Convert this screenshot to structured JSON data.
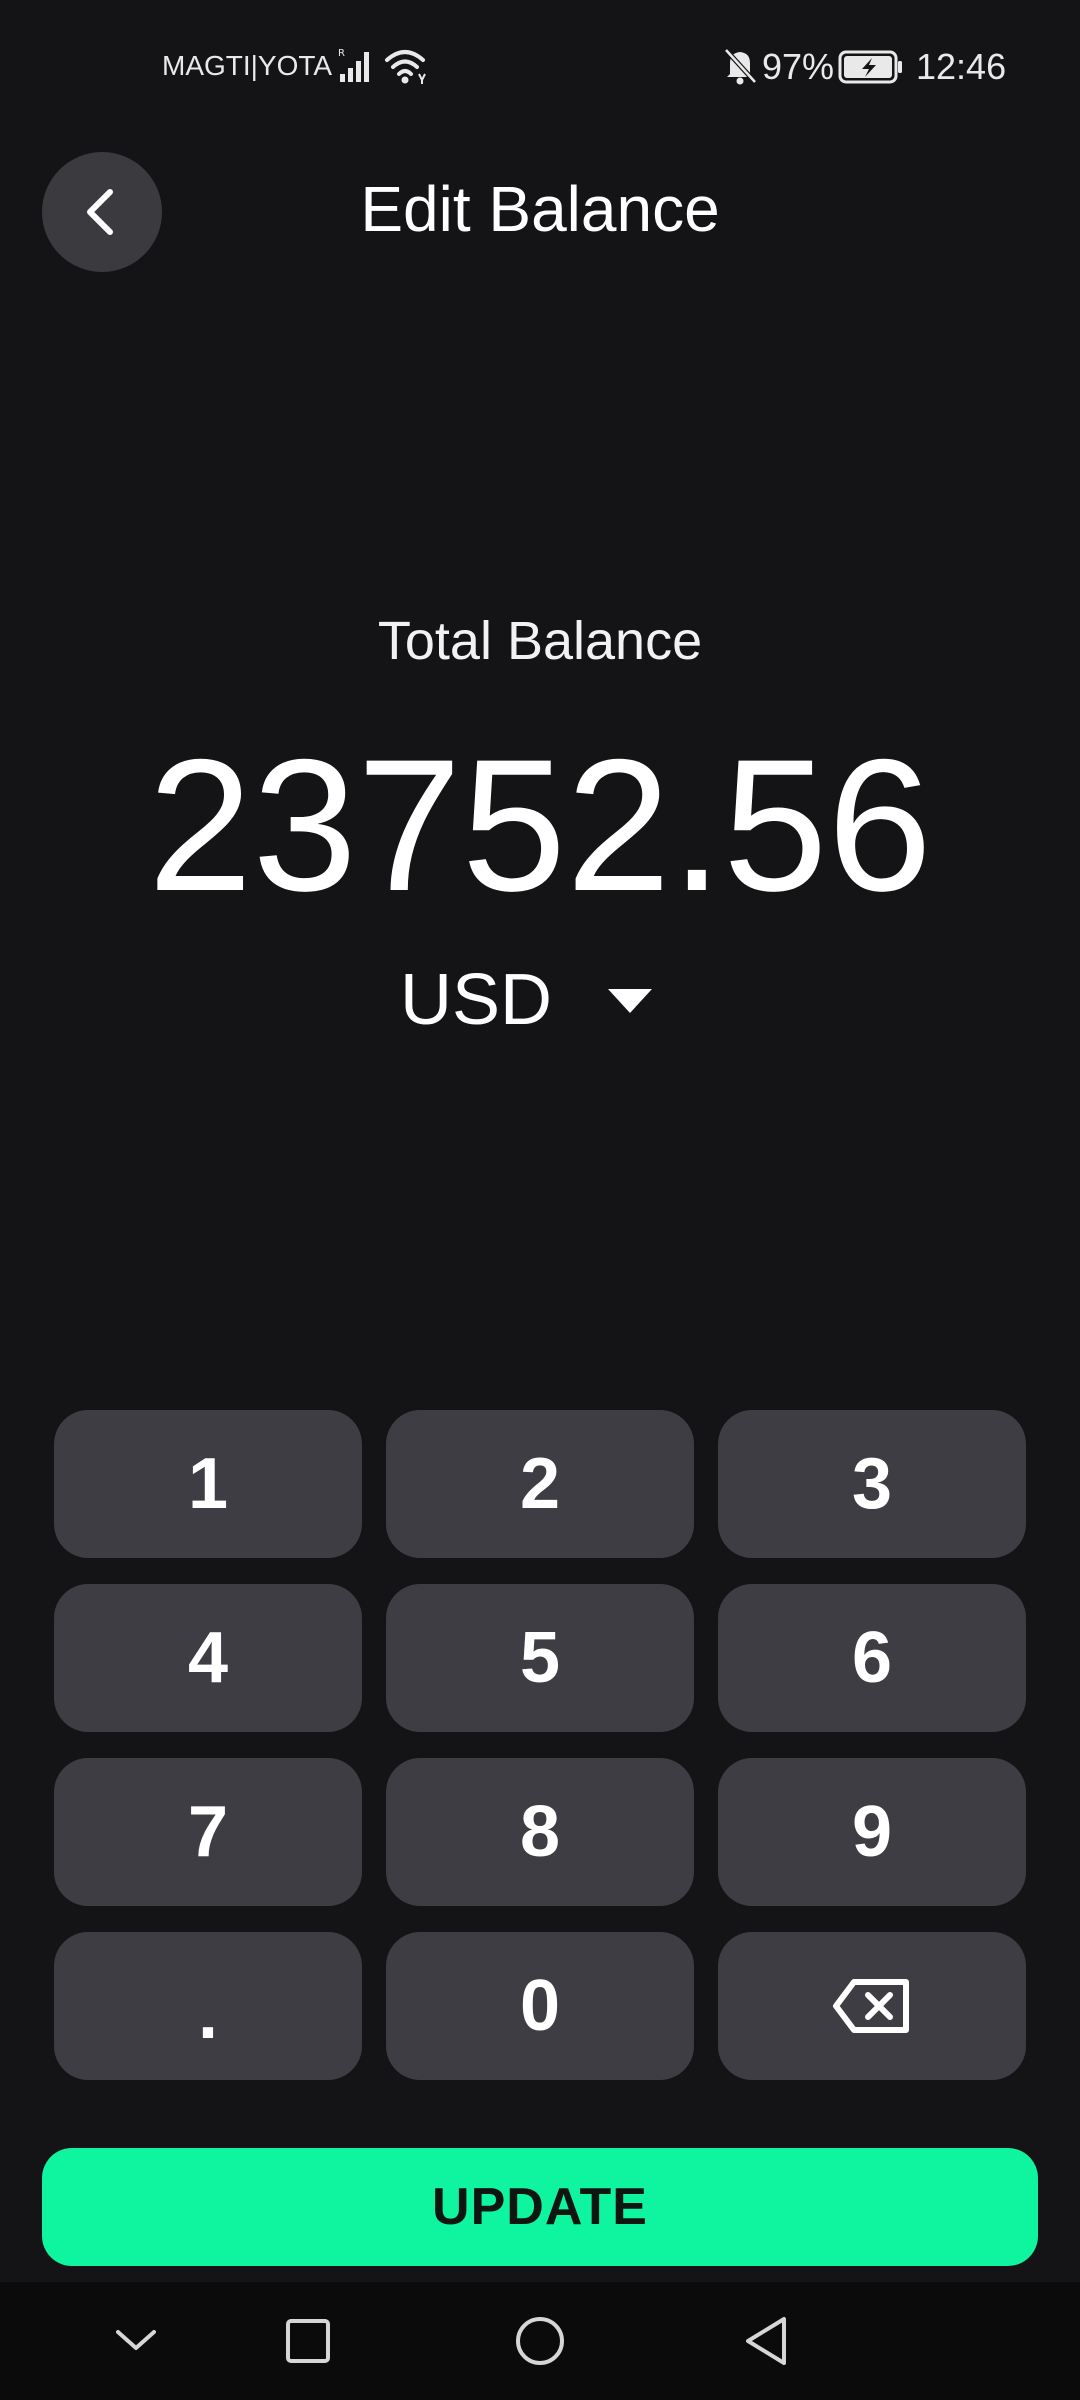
{
  "status_bar": {
    "carrier": "MAGTI|YOTA",
    "battery_percent": "97%",
    "time": "12:46",
    "icons": [
      "signal-icon",
      "wifi-icon",
      "bell-off-icon",
      "battery-charging-icon"
    ]
  },
  "header": {
    "title": "Edit Balance",
    "back_icon": "chevron-left-icon"
  },
  "balance": {
    "label": "Total Balance",
    "value": "23752.56",
    "currency": "USD",
    "currency_icon": "caret-down-icon"
  },
  "keypad": {
    "keys": [
      "1",
      "2",
      "3",
      "4",
      "5",
      "6",
      "7",
      "8",
      "9",
      ".",
      "0"
    ],
    "backspace_icon": "backspace-icon"
  },
  "actions": {
    "update_label": "UPDATE"
  },
  "nav_bar": {
    "icons": [
      "chevron-down-icon",
      "square-icon",
      "circle-icon",
      "triangle-back-icon"
    ]
  },
  "colors": {
    "background": "#141416",
    "key": "#3d3d43",
    "accent": "#0ff59f"
  }
}
